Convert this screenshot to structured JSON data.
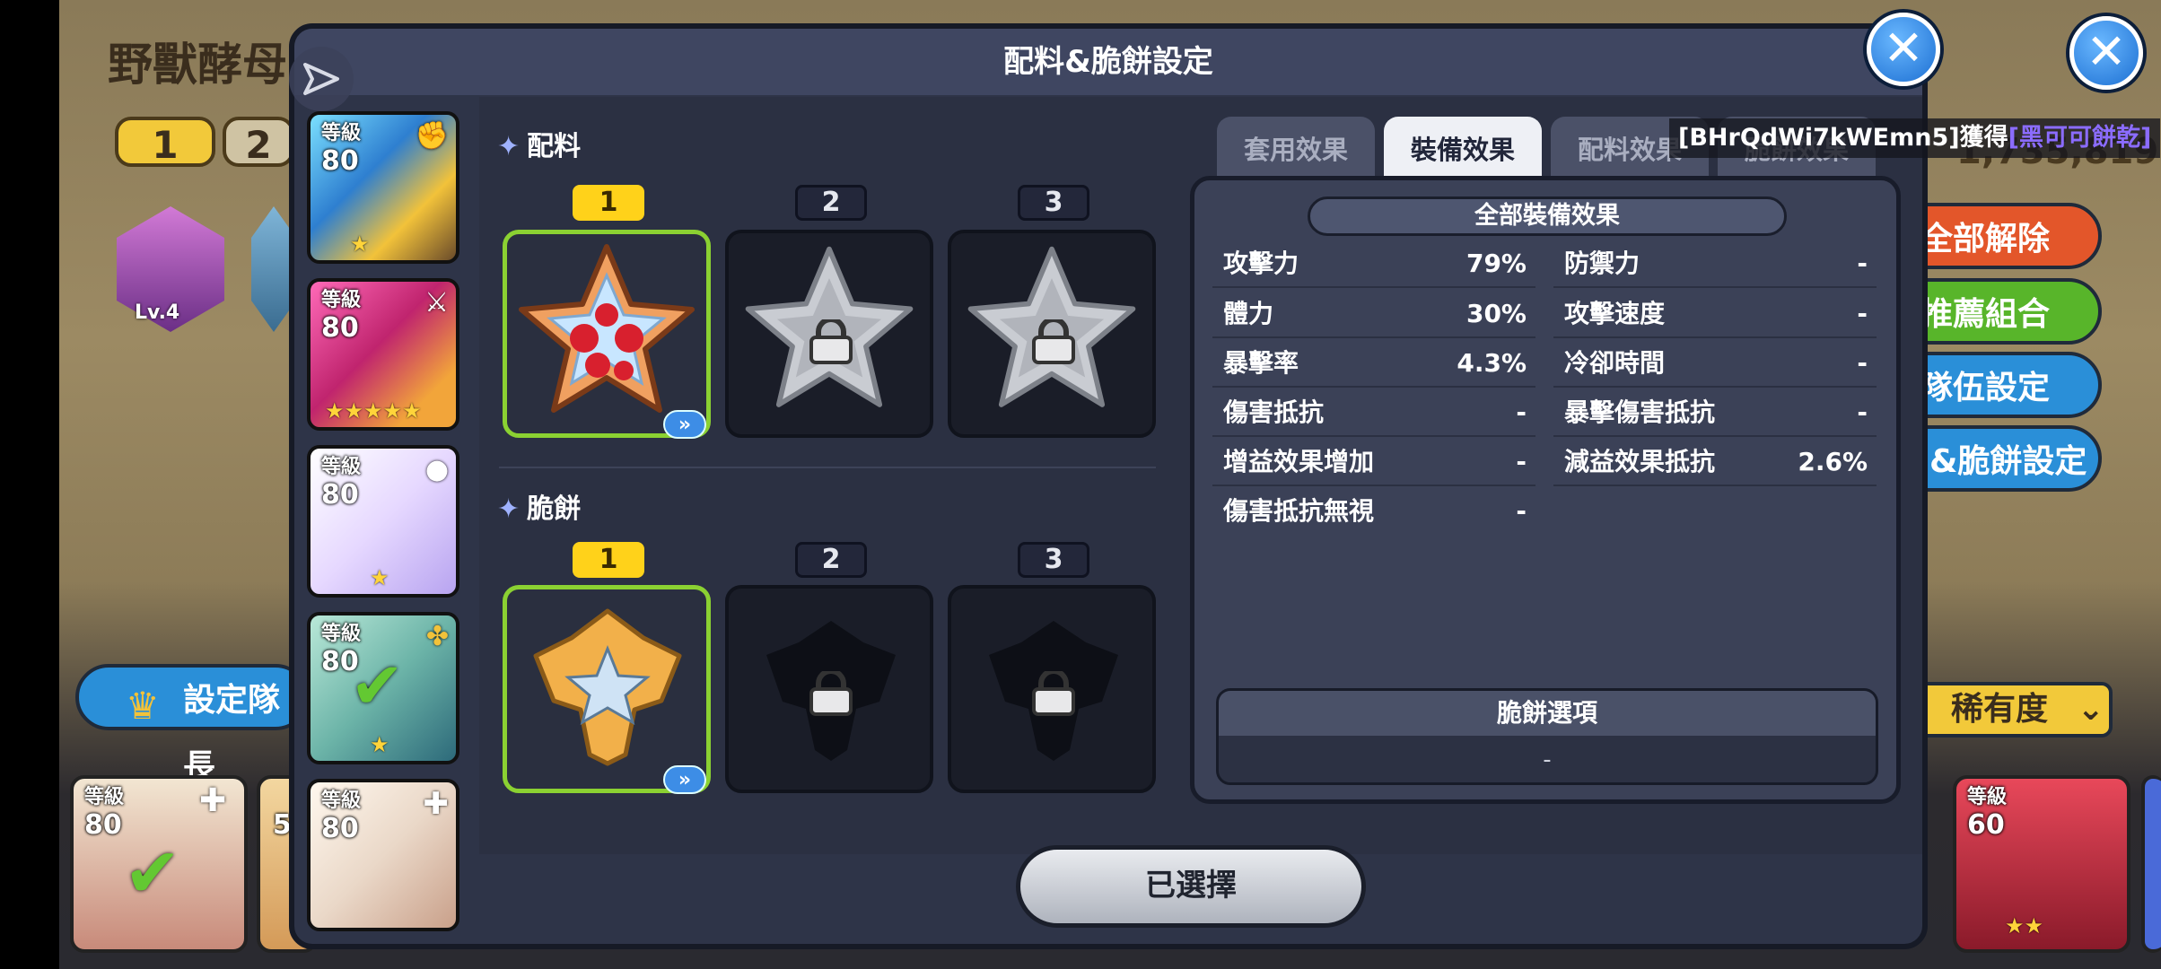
{
  "background": {
    "title": "野獸酵母",
    "tabs": [
      "1",
      "2"
    ],
    "topping_level": "Lv.4",
    "score": "1,735,819",
    "side_buttons": [
      "全部解除",
      "推薦組合",
      "隊伍設定",
      "&脆餅設定"
    ],
    "leader_button": "設定隊長",
    "sort_label": "稀有度",
    "bottom_cards": [
      {
        "level_label": "等級",
        "level": "80"
      },
      {
        "level_label": "等級",
        "level": "5"
      },
      {
        "level_label": "等級",
        "level": "60"
      }
    ]
  },
  "modal": {
    "title": "配料&脆餅設定",
    "cookies": [
      {
        "level_label": "等級",
        "level": "80",
        "stars": "★"
      },
      {
        "level_label": "等級",
        "level": "80",
        "stars": "★★★★★"
      },
      {
        "level_label": "等級",
        "level": "80",
        "stars": "★"
      },
      {
        "level_label": "等級",
        "level": "80",
        "stars": "★"
      },
      {
        "level_label": "等級",
        "level": "80",
        "stars": ""
      }
    ],
    "toppings": {
      "label": "配料",
      "slots": [
        "1",
        "2",
        "3"
      ]
    },
    "biscuits": {
      "label": "脆餅",
      "slots": [
        "1",
        "2",
        "3"
      ]
    },
    "tabs": [
      "套用效果",
      "裝備效果",
      "配料效果",
      "脆餅效果"
    ],
    "active_tab": "裝備效果",
    "notice": {
      "prefix": "[BHrQdWi7kWEmn5]獲得",
      "highlight": "[黑可可餅乾]"
    },
    "effects": {
      "header": "全部裝備效果",
      "rows": [
        {
          "k1": "攻擊力",
          "v1": "79%",
          "k2": "防禦力",
          "v2": "-"
        },
        {
          "k1": "體力",
          "v1": "30%",
          "k2": "攻擊速度",
          "v2": "-"
        },
        {
          "k1": "暴擊率",
          "v1": "4.3%",
          "k2": "冷卻時間",
          "v2": "-"
        },
        {
          "k1": "傷害抵抗",
          "v1": "-",
          "k2": "暴擊傷害抵抗",
          "v2": "-"
        },
        {
          "k1": "增益效果增加",
          "v1": "-",
          "k2": "減益效果抵抗",
          "v2": "2.6%"
        },
        {
          "k1": "傷害抵抗無視",
          "v1": "-"
        }
      ],
      "option_header": "脆餅選項",
      "option_value": "-"
    },
    "select_button": "已選擇"
  },
  "colors": {
    "accent_green": "#8bd132",
    "slot_yellow": "#ffd21a",
    "close_blue": "#1c6fd2"
  }
}
